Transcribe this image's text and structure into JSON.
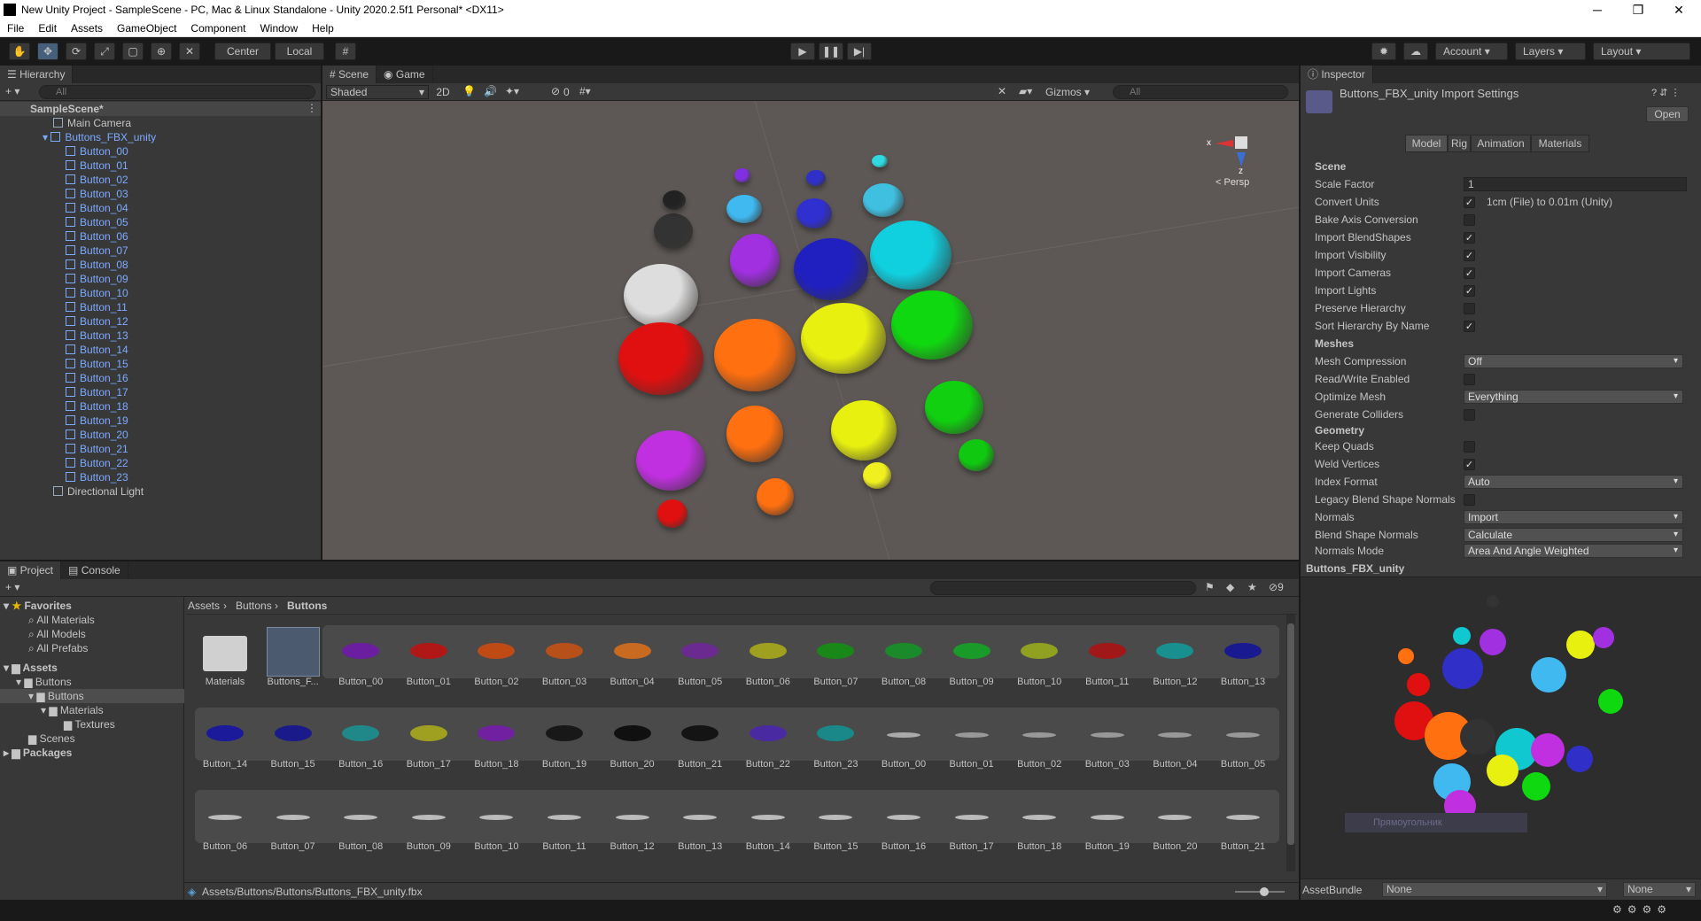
{
  "window": {
    "title": "New Unity Project - SampleScene - PC, Mac & Linux Standalone - Unity 2020.2.5f1 Personal* <DX11>",
    "minimize": "─",
    "maximize": "❐",
    "close": "✕"
  },
  "menu": [
    "File",
    "Edit",
    "Assets",
    "GameObject",
    "Component",
    "Window",
    "Help"
  ],
  "toolbar": {
    "pivot": "Center",
    "space": "Local",
    "account": "Account",
    "layers": "Layers",
    "layout": "Layout"
  },
  "hierarchy": {
    "tab": "Hierarchy",
    "search_placeholder": "All",
    "scene": "SampleScene*",
    "main_camera": "Main Camera",
    "root": "Buttons_FBX_unity",
    "children": [
      "Button_00",
      "Button_01",
      "Button_02",
      "Button_03",
      "Button_04",
      "Button_05",
      "Button_06",
      "Button_07",
      "Button_08",
      "Button_09",
      "Button_10",
      "Button_11",
      "Button_12",
      "Button_13",
      "Button_14",
      "Button_15",
      "Button_16",
      "Button_17",
      "Button_18",
      "Button_19",
      "Button_20",
      "Button_21",
      "Button_22",
      "Button_23"
    ],
    "light": "Directional Light"
  },
  "scene": {
    "tab_scene": "Scene",
    "tab_game": "Game",
    "shading": "Shaded",
    "mode_2d": "2D",
    "hidden_count": "0",
    "gizmos": "Gizmos",
    "search_placeholder": "All",
    "persp": "< Persp",
    "axis_x": "x",
    "axis_z": "z"
  },
  "inspector": {
    "tab": "Inspector",
    "title": "Buttons_FBX_unity Import Settings",
    "open": "Open",
    "tabs": [
      "Model",
      "Rig",
      "Animation",
      "Materials"
    ],
    "sections": {
      "scene": "Scene",
      "meshes": "Meshes",
      "geometry": "Geometry"
    },
    "scale_factor_label": "Scale Factor",
    "scale_factor": "1",
    "convert_units_label": "Convert Units",
    "convert_units_note": "1cm (File) to 0.01m (Unity)",
    "bake_axis": "Bake Axis Conversion",
    "import_blendshapes": "Import BlendShapes",
    "import_visibility": "Import Visibility",
    "import_cameras": "Import Cameras",
    "import_lights": "Import Lights",
    "preserve_hierarchy": "Preserve Hierarchy",
    "sort_hierarchy": "Sort Hierarchy By Name",
    "mesh_compression_label": "Mesh Compression",
    "mesh_compression": "Off",
    "read_write": "Read/Write Enabled",
    "optimize_mesh_label": "Optimize Mesh",
    "optimize_mesh": "Everything",
    "generate_colliders": "Generate Colliders",
    "keep_quads": "Keep Quads",
    "weld_vertices": "Weld Vertices",
    "index_format_label": "Index Format",
    "index_format": "Auto",
    "legacy_blend": "Legacy Blend Shape Normals",
    "normals_label": "Normals",
    "normals": "Import",
    "blend_normals_label": "Blend Shape Normals",
    "blend_normals": "Calculate",
    "normals_mode_label": "Normals Mode",
    "normals_mode": "Area And Angle Weighted",
    "preview_title": "Buttons_FBX_unity",
    "preview_overlay": "Прямоугольник",
    "assetbundle_label": "AssetBundle",
    "assetbundle": "None",
    "assetbundle_variant": "None"
  },
  "project": {
    "tab_project": "Project",
    "tab_console": "Console",
    "favorites": "Favorites",
    "fav_items": [
      "All Materials",
      "All Models",
      "All Prefabs"
    ],
    "assets": "Assets",
    "tree": [
      "Buttons",
      "Buttons",
      "Materials",
      "Textures",
      "Scenes"
    ],
    "packages": "Packages",
    "breadcrumb": [
      "Assets",
      "Buttons",
      "Buttons"
    ],
    "hidden_count": "9",
    "status_path": "Assets/Buttons/Buttons/Buttons_FBX_unity.fbx",
    "row1": [
      "Materials",
      "Buttons_F...",
      "Button_00",
      "Button_01",
      "Button_02",
      "Button_03",
      "Button_04",
      "Button_05",
      "Button_06",
      "Button_07",
      "Button_08",
      "Button_09",
      "Button_10",
      "Button_11",
      "Button_12",
      "Button_13"
    ],
    "row2": [
      "Button_14",
      "Button_15",
      "Button_16",
      "Button_17",
      "Button_18",
      "Button_19",
      "Button_20",
      "Button_21",
      "Button_22",
      "Button_23",
      "Button_00",
      "Button_01",
      "Button_02",
      "Button_03",
      "Button_04",
      "Button_05"
    ],
    "row3": [
      "Button_06",
      "Button_07",
      "Button_08",
      "Button_09",
      "Button_10",
      "Button_11",
      "Button_12",
      "Button_13",
      "Button_14",
      "Button_15",
      "Button_16",
      "Button_17",
      "Button_18",
      "Button_19",
      "Button_20",
      "Button_21"
    ],
    "row1_colors": [
      "#c9c9c9",
      "#6a6a8a",
      "#6b1fa0",
      "#b01818",
      "#c04a14",
      "#b8501a",
      "#c86a20",
      "#6a2a90",
      "#a0a020",
      "#188818",
      "#1a8a2a",
      "#1a9a28",
      "#90a020",
      "#a01818",
      "#189090",
      "#1a1a90"
    ],
    "row2_colors": [
      "#1a1a9a",
      "#1a1a8a",
      "#208888",
      "#a0a020",
      "#7020a0",
      "#181818",
      "#101010",
      "#141414",
      "#4a2aa0",
      "#1a8888",
      "#aaaaaa",
      "#999999",
      "#999999",
      "#999999",
      "#999999",
      "#999999"
    ]
  }
}
